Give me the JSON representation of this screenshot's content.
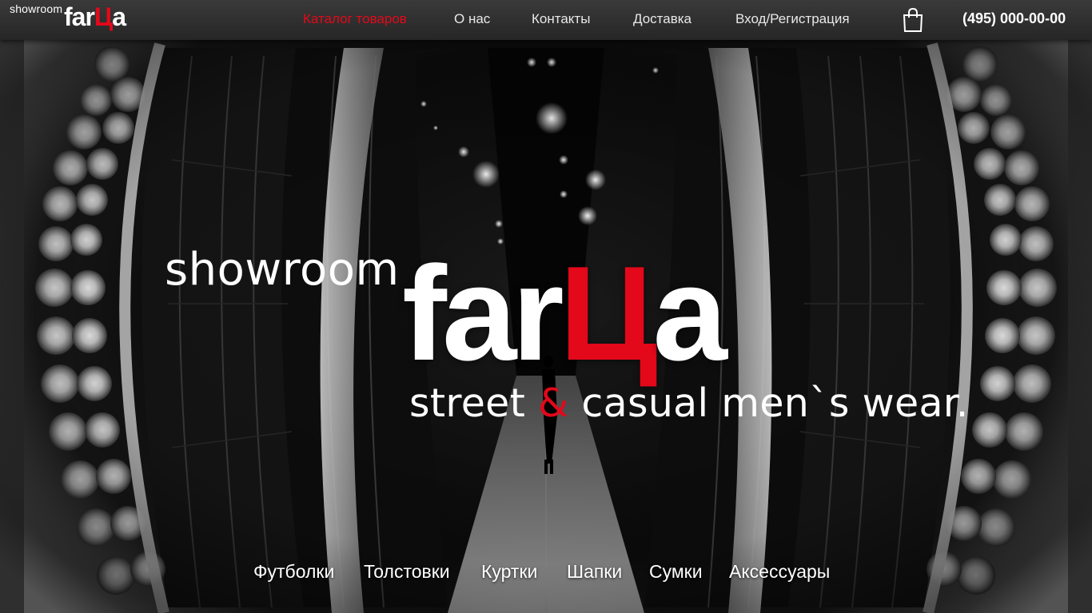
{
  "header": {
    "logo": {
      "pre": "showroom",
      "brand_main": "far",
      "brand_accent": "Ц",
      "brand_end": "a"
    },
    "nav": [
      {
        "label": "Каталог товаров",
        "active": true
      },
      {
        "label": "О нас",
        "active": false
      },
      {
        "label": "Контакты",
        "active": false
      },
      {
        "label": "Доставка",
        "active": false
      },
      {
        "label": "Вход/Регистрация",
        "active": false
      }
    ],
    "cart_icon": "shopping-bag-icon",
    "phone": "(495) 000-00-00"
  },
  "hero": {
    "pre": "showroom",
    "brand_main": "far",
    "brand_accent": "Ц",
    "brand_end": "a",
    "tagline_part1": "street",
    "tagline_amp": "&",
    "tagline_part2": "casual men`s wear."
  },
  "categories": [
    "Футболки",
    "Толстовки",
    "Куртки",
    "Шапки",
    "Сумки",
    "Аксессуары"
  ],
  "colors": {
    "accent": "#e3081a",
    "topbar": "#2f2f2f",
    "text": "#ffffff"
  }
}
